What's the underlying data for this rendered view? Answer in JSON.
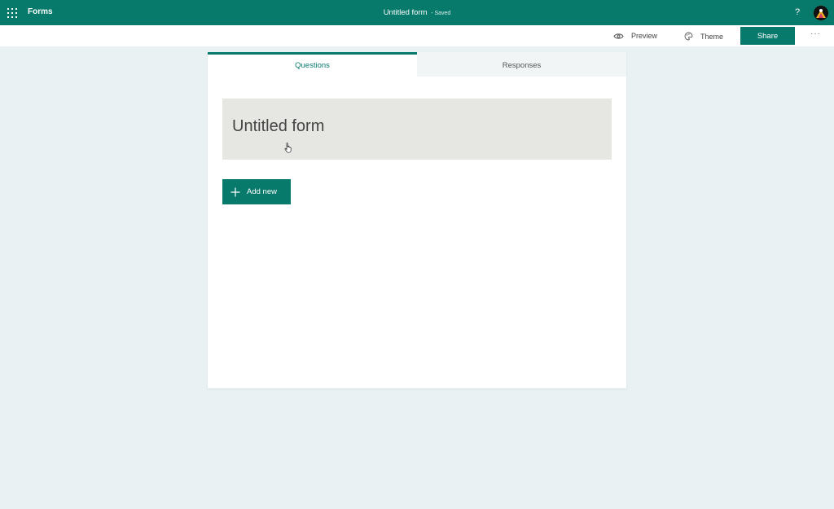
{
  "header": {
    "app_name": "Forms",
    "document_title": "Untitled form",
    "save_status": "- Saved",
    "help_label": "?"
  },
  "commands": {
    "preview_label": "Preview",
    "theme_label": "Theme",
    "share_label": "Share",
    "more_label": "···"
  },
  "tabs": [
    {
      "label": "Questions",
      "active": true
    },
    {
      "label": "Responses",
      "active": false
    }
  ],
  "form": {
    "title": "Untitled form",
    "add_new_label": "Add new"
  },
  "colors": {
    "brand": "#077a6c",
    "background": "#e9f1f2",
    "title_box": "#e6e6e3"
  },
  "icons": {
    "app_launcher": "waffle-icon",
    "preview": "eye-icon",
    "theme": "palette-icon",
    "more": "ellipsis-icon",
    "add": "plus-icon",
    "cursor": "hand-pointer-icon"
  }
}
